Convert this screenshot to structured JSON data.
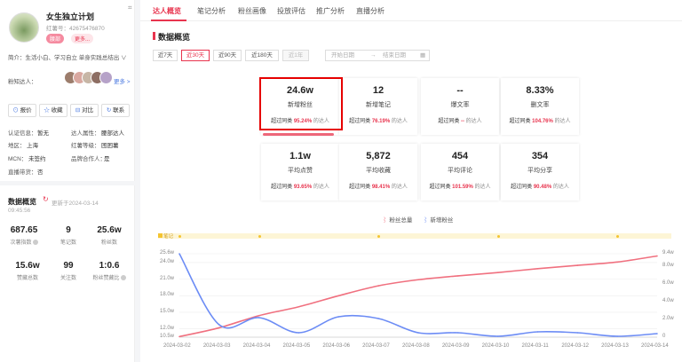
{
  "profile": {
    "name": "女生独立计划",
    "id_label": "红薯号：42675476870",
    "tag1": "腰部",
    "tag2": "更多...",
    "bio": "简介：生活小白、学习自立 单身实践总结出 ∨"
  },
  "followers": {
    "label": "粉知达人：",
    "more": "更多 >"
  },
  "actions": [
    "报价",
    "收藏",
    "对比",
    "联系"
  ],
  "attrs": [
    {
      "k": "认证信息：",
      "v": "暂无"
    },
    {
      "k": "达人属性：",
      "v": "腰部达人"
    },
    {
      "k": "地区：",
      "v": "上海"
    },
    {
      "k": "红薯等级：",
      "v": "困困薯"
    },
    {
      "k": "MCN：",
      "v": "未签约"
    },
    {
      "k": "品牌合作人：",
      "v": "是"
    },
    {
      "k": "直播带货：",
      "v": "否"
    }
  ],
  "overview": {
    "title": "数据概览",
    "updated": "更新于2024-03-14",
    "updated_time": "09:45:56"
  },
  "stats": [
    {
      "v": "687.65",
      "l": "次薯指数"
    },
    {
      "v": "9",
      "l": "笔记数"
    },
    {
      "v": "25.6w",
      "l": "粉丝数"
    },
    {
      "v": "15.6w",
      "l": "赞藏总数"
    },
    {
      "v": "99",
      "l": "关注数"
    },
    {
      "v": "1:0.6",
      "l": "粉丝赞藏比"
    }
  ],
  "tabs": [
    "达人概览",
    "笔记分析",
    "粉丝画像",
    "投放评估",
    "推广分析",
    "直播分析"
  ],
  "section_title": "数据概览",
  "ranges": [
    "近7天",
    "近30天",
    "近90天",
    "近180天",
    "近1年"
  ],
  "date": {
    "start": "开始日期",
    "arrow": "→",
    "end": "结束日期"
  },
  "cards": [
    {
      "value": "24.6w",
      "label": "新增粉丝",
      "pre": "超过同类",
      "pct": "95.24%",
      "post": "的达人"
    },
    {
      "value": "12",
      "label": "新增笔记",
      "pre": "超过同类",
      "pct": "76.19%",
      "post": "的达人"
    },
    {
      "value": "--",
      "label": "爆文率",
      "pre": "超过同类",
      "pct": "--",
      "post": "的达人"
    },
    {
      "value": "8.33%",
      "label": "删文率",
      "pre": "超过同类",
      "pct": "104.76%",
      "post": "的达人"
    },
    {
      "value": "1.1w",
      "label": "平均点赞",
      "pre": "超过同类",
      "pct": "93.65%",
      "post": "的达人"
    },
    {
      "value": "5,872",
      "label": "平均收藏",
      "pre": "超过同类",
      "pct": "98.41%",
      "post": "的达人"
    },
    {
      "value": "454",
      "label": "平均评论",
      "pre": "超过同类",
      "pct": "101.59%",
      "post": "的达人"
    },
    {
      "value": "354",
      "label": "平均分享",
      "pre": "超过同类",
      "pct": "90.48%",
      "post": "的达人"
    }
  ],
  "colors": {
    "accent": "#e8344e",
    "total": "#f0707f",
    "new": "#6c8cf5"
  },
  "chart_data": {
    "type": "line",
    "legend": [
      "粉丝总量",
      "新增粉丝"
    ],
    "note_marker": "笔记",
    "x": [
      "2024-03-02",
      "2024-03-03",
      "2024-03-04",
      "2024-03-05",
      "2024-03-06",
      "2024-03-07",
      "2024-03-08",
      "2024-03-09",
      "2024-03-10",
      "2024-03-11",
      "2024-03-12",
      "2024-03-13",
      "2024-03-14"
    ],
    "left_ticks": [
      "25.6w",
      "24.0w",
      "21.0w",
      "18.0w",
      "15.0w",
      "12.0w",
      "10.5w"
    ],
    "right_ticks": [
      "9.4w",
      "8.0w",
      "6.0w",
      "4.0w",
      "2.0w",
      "0"
    ],
    "series": [
      {
        "name": "粉丝总量",
        "axis": "left",
        "values": [
          10.6,
          12.2,
          14.4,
          16.0,
          18.0,
          19.8,
          20.9,
          21.6,
          22.2,
          22.9,
          23.5,
          24.1,
          25.2
        ]
      },
      {
        "name": "新增粉丝",
        "axis": "right",
        "values": [
          9.4,
          1.4,
          2.2,
          0.5,
          2.3,
          2.1,
          0.5,
          0.5,
          0.1,
          0.6,
          0.5,
          0.1,
          0.4
        ]
      }
    ],
    "note_days": [
      "2024-03-02",
      "2024-03-04",
      "2024-03-07",
      "2024-03-10",
      "2024-03-13"
    ]
  }
}
